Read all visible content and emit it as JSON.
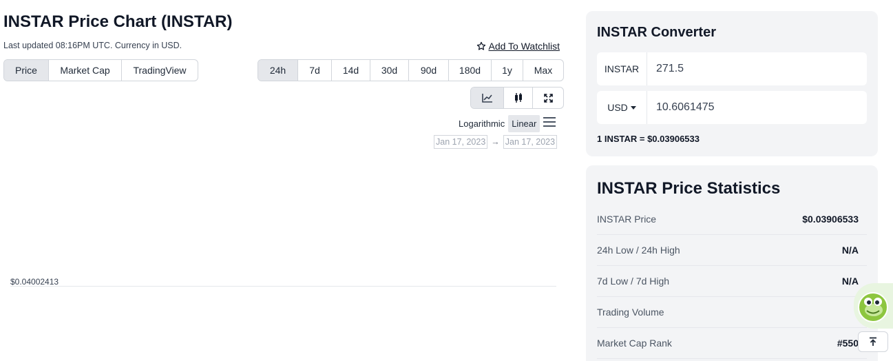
{
  "header": {
    "title": "INSTAR Price Chart (INSTAR)",
    "updated": "Last updated 08:16PM UTC. Currency in USD.",
    "watchlist": "Add To Watchlist"
  },
  "tabs": [
    {
      "label": "Price",
      "active": true
    },
    {
      "label": "Market Cap",
      "active": false
    },
    {
      "label": "TradingView",
      "active": false
    }
  ],
  "ranges": [
    {
      "label": "24h",
      "active": true
    },
    {
      "label": "7d",
      "active": false
    },
    {
      "label": "14d",
      "active": false
    },
    {
      "label": "30d",
      "active": false
    },
    {
      "label": "90d",
      "active": false
    },
    {
      "label": "180d",
      "active": false
    },
    {
      "label": "1y",
      "active": false
    },
    {
      "label": "Max",
      "active": false
    }
  ],
  "chart_types": [
    {
      "icon": "line-chart-icon",
      "active": true
    },
    {
      "icon": "candlestick-icon",
      "active": false
    },
    {
      "icon": "fullscreen-icon",
      "active": false
    }
  ],
  "scale": {
    "log": "Logarithmic",
    "linear": "Linear",
    "active": "Linear"
  },
  "dates": {
    "from": "Jan 17, 2023",
    "to": "Jan 17, 2023",
    "arrow": "→"
  },
  "chart": {
    "y_label": "$0.04002413"
  },
  "converter": {
    "title": "INSTAR Converter",
    "from_currency": "INSTAR",
    "from_value": "271.5",
    "to_currency": "USD",
    "to_value": "10.6061475",
    "rate": "1 INSTAR = $0.03906533"
  },
  "stats": {
    "title": "INSTAR Price Statistics",
    "rows": [
      {
        "label": "INSTAR Price",
        "value": "$0.03906533"
      },
      {
        "label": "24h Low / 24h High",
        "value": "N/A"
      },
      {
        "label": "7d Low / 7d High",
        "value": "N/A"
      },
      {
        "label": "Trading Volume",
        "value": "-"
      },
      {
        "label": "Market Cap Rank",
        "value": "#550"
      }
    ]
  },
  "colors": {
    "accent_green": "#8dc63f",
    "active_bg": "#e5e7eb",
    "card_bg": "#f3f4f6"
  }
}
